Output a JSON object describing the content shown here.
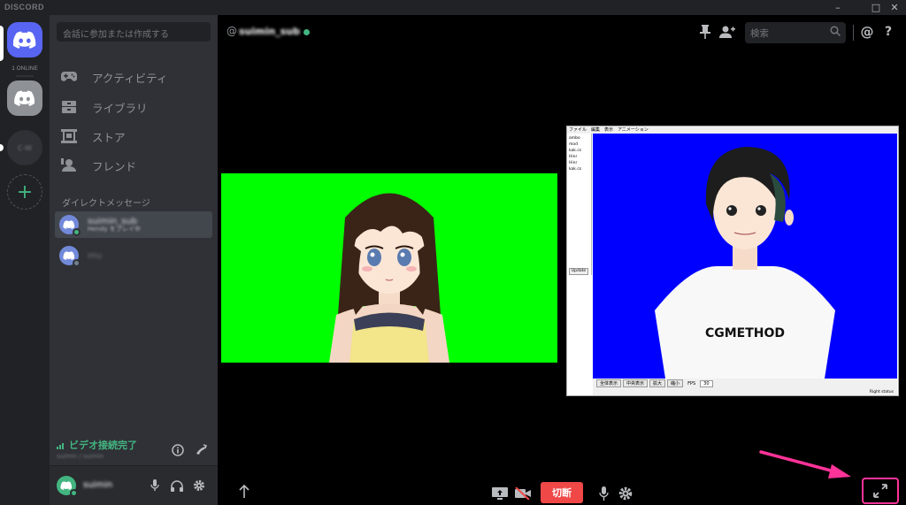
{
  "titlebar": {
    "brand": "DISCORD"
  },
  "guilds": {
    "online_label": "1 ONLINE"
  },
  "sidebar": {
    "search_placeholder": "会話に参加または作成する",
    "nav": [
      {
        "label": "アクティビティ",
        "icon": "gamepad-icon"
      },
      {
        "label": "ライブラリ",
        "icon": "library-icon"
      },
      {
        "label": "ストア",
        "icon": "store-icon"
      },
      {
        "label": "フレンド",
        "icon": "friends-icon"
      }
    ],
    "dm_header": "ダイレクトメッセージ",
    "dms": [
      {
        "name": "suimin_sub",
        "sub": "Hendy をプレイ中",
        "status_color": "#43b581",
        "active": true
      },
      {
        "name": "mu",
        "sub": "",
        "status_color": "#747f8d",
        "active": false
      }
    ],
    "voice": {
      "status": "ビデオ接続完了",
      "sub": "suimin / suimin"
    },
    "user": {
      "name": "suimin"
    }
  },
  "main": {
    "channel_at": "@",
    "channel_name": "suimin_sub",
    "search_placeholder": "検索",
    "hangup_label": "切断"
  },
  "app_window": {
    "menu": "ファイル　編集　表示　アニメーション",
    "tree": [
      "ambo mod",
      "kak.cs",
      "Hinr",
      "Hinr",
      "kak.cs"
    ],
    "update_btn": "Update",
    "toolbar": [
      "全体表示",
      "中央表示",
      "拡大",
      "縮小"
    ],
    "fps_label": "FPS",
    "fps_value": "30",
    "status": "Right status",
    "shirt_text": "CGMETHOD"
  },
  "colors": {
    "accent": "#5865f2",
    "online": "#43b581",
    "danger": "#f04747",
    "highlight": "#ff3399"
  }
}
